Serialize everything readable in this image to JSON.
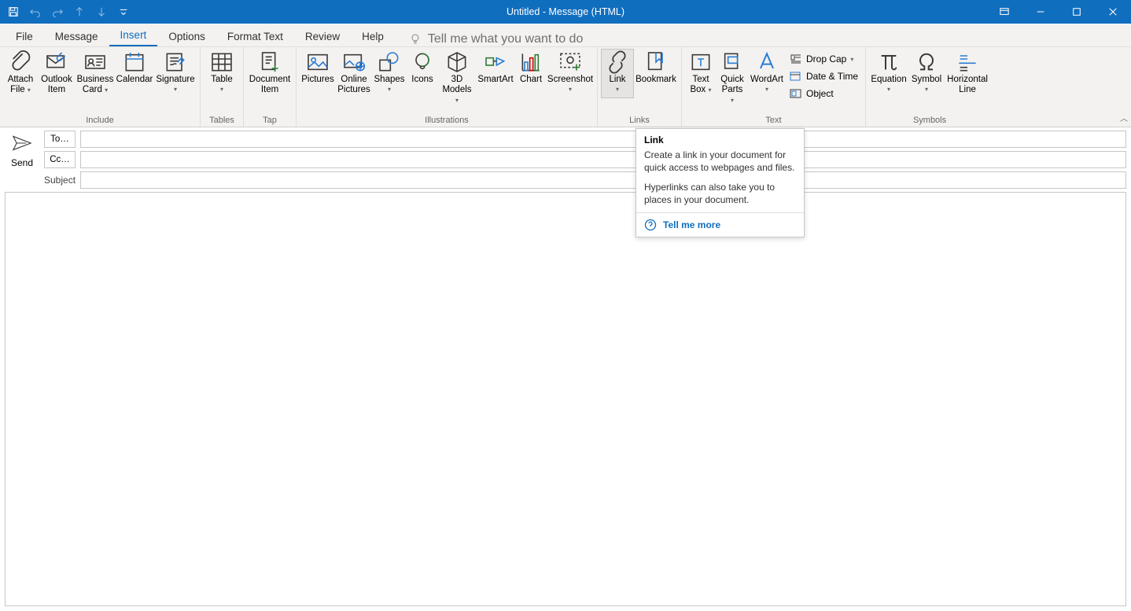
{
  "title": "Untitled  -  Message (HTML)",
  "qat": {
    "save": "Save",
    "undo": "Undo",
    "redo": "Redo",
    "prev": "Previous",
    "next": "Next",
    "customize": "Customize"
  },
  "tabs": {
    "file": "File",
    "message": "Message",
    "insert": "Insert",
    "options": "Options",
    "format": "Format Text",
    "review": "Review",
    "help": "Help",
    "tellme": "Tell me what you want to do"
  },
  "groups": {
    "include": {
      "label": "Include",
      "attach_file": "Attach",
      "attach_file2": "File",
      "outlook_item": "Outlook",
      "outlook_item2": "Item",
      "business_card": "Business",
      "business_card2": "Card",
      "calendar": "Calendar",
      "signature": "Signature"
    },
    "tables": {
      "label": "Tables",
      "table": "Table"
    },
    "tap": {
      "label": "Tap",
      "doc_item": "Document",
      "doc_item2": "Item"
    },
    "illustrations": {
      "label": "Illustrations",
      "pictures": "Pictures",
      "online_pictures": "Online",
      "online_pictures2": "Pictures",
      "shapes": "Shapes",
      "icons": "Icons",
      "models": "3D",
      "models2": "Models",
      "smartart": "SmartArt",
      "chart": "Chart",
      "screenshot": "Screenshot"
    },
    "links": {
      "label": "Links",
      "link": "Link",
      "bookmark": "Bookmark"
    },
    "text": {
      "label": "Text",
      "text_box": "Text",
      "text_box2": "Box",
      "quick_parts": "Quick",
      "quick_parts2": "Parts",
      "wordart": "WordArt",
      "drop_cap": "Drop Cap",
      "date_time": "Date & Time",
      "object": "Object"
    },
    "symbols": {
      "label": "Symbols",
      "equation": "Equation",
      "symbol": "Symbol",
      "hline": "Horizontal",
      "hline2": "Line"
    }
  },
  "send": "Send",
  "fields": {
    "to": "To…",
    "cc": "Cc…",
    "subject": "Subject"
  },
  "tooltip": {
    "title": "Link",
    "p1": "Create a link in your document for quick access to webpages and files.",
    "p2": "Hyperlinks can also take you to places in your document.",
    "more": "Tell me more"
  }
}
